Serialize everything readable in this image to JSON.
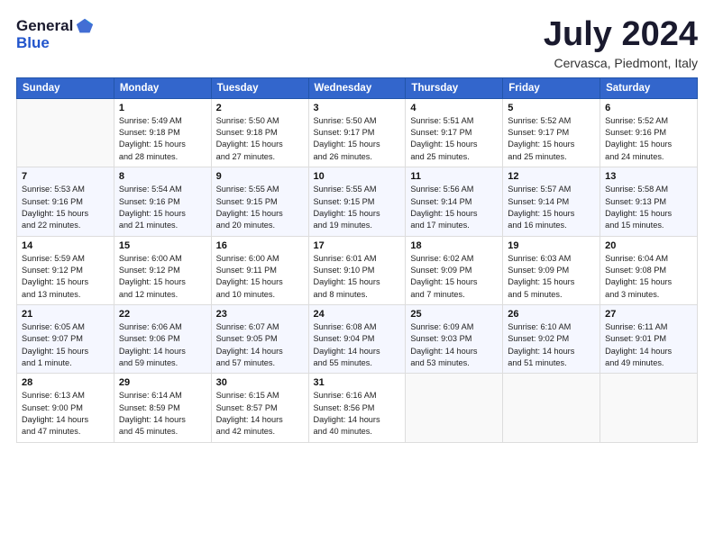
{
  "logo": {
    "general": "General",
    "blue": "Blue"
  },
  "title": "July 2024",
  "location": "Cervasca, Piedmont, Italy",
  "days_of_week": [
    "Sunday",
    "Monday",
    "Tuesday",
    "Wednesday",
    "Thursday",
    "Friday",
    "Saturday"
  ],
  "weeks": [
    [
      {
        "day": "",
        "info": ""
      },
      {
        "day": "1",
        "info": "Sunrise: 5:49 AM\nSunset: 9:18 PM\nDaylight: 15 hours\nand 28 minutes."
      },
      {
        "day": "2",
        "info": "Sunrise: 5:50 AM\nSunset: 9:18 PM\nDaylight: 15 hours\nand 27 minutes."
      },
      {
        "day": "3",
        "info": "Sunrise: 5:50 AM\nSunset: 9:17 PM\nDaylight: 15 hours\nand 26 minutes."
      },
      {
        "day": "4",
        "info": "Sunrise: 5:51 AM\nSunset: 9:17 PM\nDaylight: 15 hours\nand 25 minutes."
      },
      {
        "day": "5",
        "info": "Sunrise: 5:52 AM\nSunset: 9:17 PM\nDaylight: 15 hours\nand 25 minutes."
      },
      {
        "day": "6",
        "info": "Sunrise: 5:52 AM\nSunset: 9:16 PM\nDaylight: 15 hours\nand 24 minutes."
      }
    ],
    [
      {
        "day": "7",
        "info": "Sunrise: 5:53 AM\nSunset: 9:16 PM\nDaylight: 15 hours\nand 22 minutes."
      },
      {
        "day": "8",
        "info": "Sunrise: 5:54 AM\nSunset: 9:16 PM\nDaylight: 15 hours\nand 21 minutes."
      },
      {
        "day": "9",
        "info": "Sunrise: 5:55 AM\nSunset: 9:15 PM\nDaylight: 15 hours\nand 20 minutes."
      },
      {
        "day": "10",
        "info": "Sunrise: 5:55 AM\nSunset: 9:15 PM\nDaylight: 15 hours\nand 19 minutes."
      },
      {
        "day": "11",
        "info": "Sunrise: 5:56 AM\nSunset: 9:14 PM\nDaylight: 15 hours\nand 17 minutes."
      },
      {
        "day": "12",
        "info": "Sunrise: 5:57 AM\nSunset: 9:14 PM\nDaylight: 15 hours\nand 16 minutes."
      },
      {
        "day": "13",
        "info": "Sunrise: 5:58 AM\nSunset: 9:13 PM\nDaylight: 15 hours\nand 15 minutes."
      }
    ],
    [
      {
        "day": "14",
        "info": "Sunrise: 5:59 AM\nSunset: 9:12 PM\nDaylight: 15 hours\nand 13 minutes."
      },
      {
        "day": "15",
        "info": "Sunrise: 6:00 AM\nSunset: 9:12 PM\nDaylight: 15 hours\nand 12 minutes."
      },
      {
        "day": "16",
        "info": "Sunrise: 6:00 AM\nSunset: 9:11 PM\nDaylight: 15 hours\nand 10 minutes."
      },
      {
        "day": "17",
        "info": "Sunrise: 6:01 AM\nSunset: 9:10 PM\nDaylight: 15 hours\nand 8 minutes."
      },
      {
        "day": "18",
        "info": "Sunrise: 6:02 AM\nSunset: 9:09 PM\nDaylight: 15 hours\nand 7 minutes."
      },
      {
        "day": "19",
        "info": "Sunrise: 6:03 AM\nSunset: 9:09 PM\nDaylight: 15 hours\nand 5 minutes."
      },
      {
        "day": "20",
        "info": "Sunrise: 6:04 AM\nSunset: 9:08 PM\nDaylight: 15 hours\nand 3 minutes."
      }
    ],
    [
      {
        "day": "21",
        "info": "Sunrise: 6:05 AM\nSunset: 9:07 PM\nDaylight: 15 hours\nand 1 minute."
      },
      {
        "day": "22",
        "info": "Sunrise: 6:06 AM\nSunset: 9:06 PM\nDaylight: 14 hours\nand 59 minutes."
      },
      {
        "day": "23",
        "info": "Sunrise: 6:07 AM\nSunset: 9:05 PM\nDaylight: 14 hours\nand 57 minutes."
      },
      {
        "day": "24",
        "info": "Sunrise: 6:08 AM\nSunset: 9:04 PM\nDaylight: 14 hours\nand 55 minutes."
      },
      {
        "day": "25",
        "info": "Sunrise: 6:09 AM\nSunset: 9:03 PM\nDaylight: 14 hours\nand 53 minutes."
      },
      {
        "day": "26",
        "info": "Sunrise: 6:10 AM\nSunset: 9:02 PM\nDaylight: 14 hours\nand 51 minutes."
      },
      {
        "day": "27",
        "info": "Sunrise: 6:11 AM\nSunset: 9:01 PM\nDaylight: 14 hours\nand 49 minutes."
      }
    ],
    [
      {
        "day": "28",
        "info": "Sunrise: 6:13 AM\nSunset: 9:00 PM\nDaylight: 14 hours\nand 47 minutes."
      },
      {
        "day": "29",
        "info": "Sunrise: 6:14 AM\nSunset: 8:59 PM\nDaylight: 14 hours\nand 45 minutes."
      },
      {
        "day": "30",
        "info": "Sunrise: 6:15 AM\nSunset: 8:57 PM\nDaylight: 14 hours\nand 42 minutes."
      },
      {
        "day": "31",
        "info": "Sunrise: 6:16 AM\nSunset: 8:56 PM\nDaylight: 14 hours\nand 40 minutes."
      },
      {
        "day": "",
        "info": ""
      },
      {
        "day": "",
        "info": ""
      },
      {
        "day": "",
        "info": ""
      }
    ]
  ]
}
